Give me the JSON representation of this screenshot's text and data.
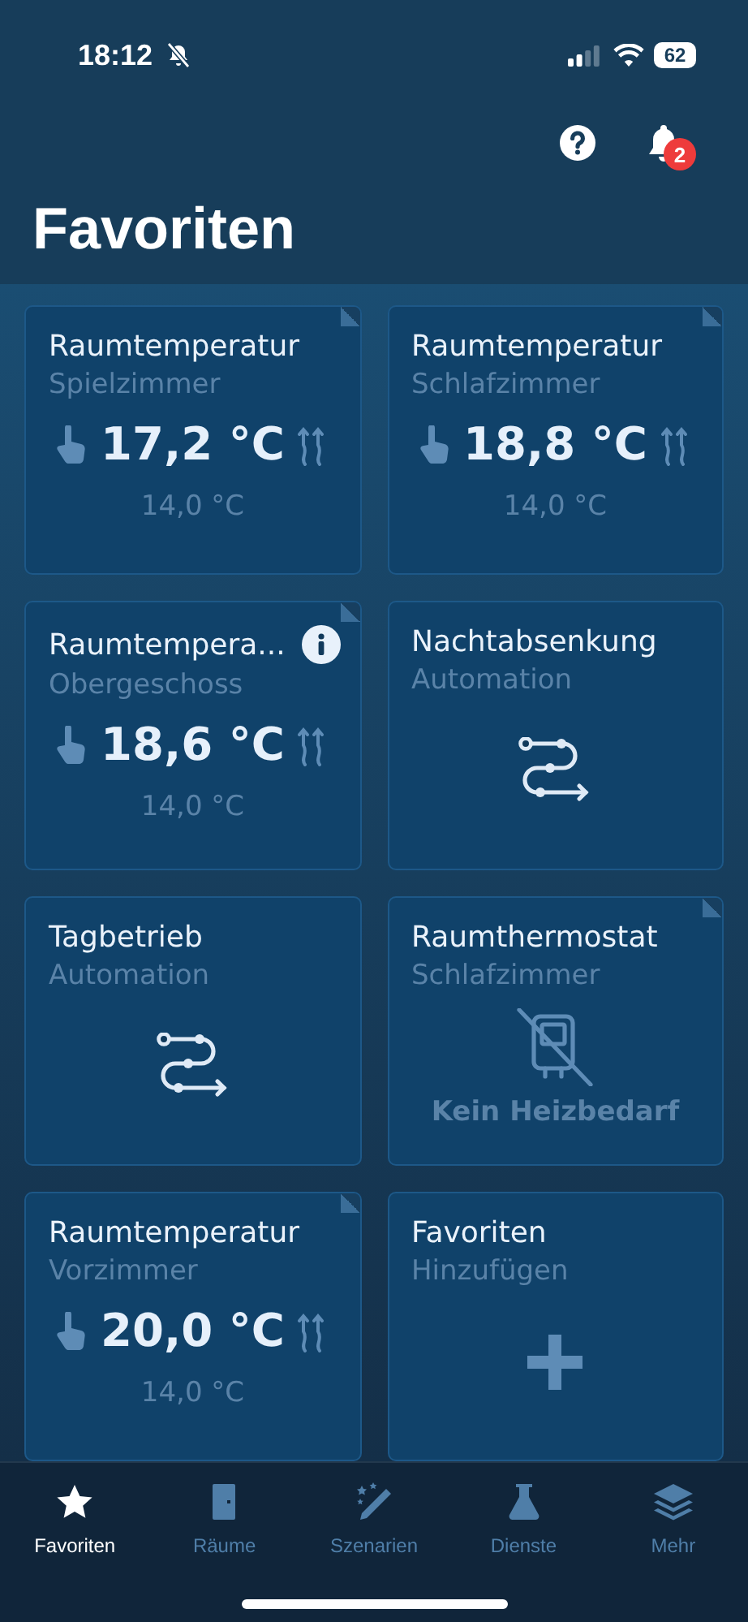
{
  "status_bar": {
    "time": "18:12",
    "battery": "62"
  },
  "header": {
    "notification_count": "2",
    "title": "Favoriten"
  },
  "cards": [
    {
      "kind": "temperature",
      "title": "Raumtemperatur",
      "subtitle": "Spielzimmer",
      "temperature": "17,2 °C",
      "setpoint": "14,0 °C",
      "corner": true,
      "info": false
    },
    {
      "kind": "temperature",
      "title": "Raumtemperatur",
      "subtitle": "Schlafzimmer",
      "temperature": "18,8 °C",
      "setpoint": "14,0 °C",
      "corner": true,
      "info": false
    },
    {
      "kind": "temperature",
      "title": "Raumtempera...",
      "subtitle": "Obergeschoss",
      "temperature": "18,6 °C",
      "setpoint": "14,0 °C",
      "corner": true,
      "info": true
    },
    {
      "kind": "automation",
      "title": "Nachtabsenkung",
      "subtitle": "Automation",
      "corner": false,
      "info": false
    },
    {
      "kind": "automation",
      "title": "Tagbetrieb",
      "subtitle": "Automation",
      "corner": false,
      "info": false
    },
    {
      "kind": "thermostat",
      "title": "Raumthermostat",
      "subtitle": "Schlafzimmer",
      "status": "Kein Heizbedarf",
      "corner": true,
      "info": false
    },
    {
      "kind": "temperature",
      "title": "Raumtemperatur",
      "subtitle": "Vorzimmer",
      "temperature": "20,0 °C",
      "setpoint": "14,0 °C",
      "corner": true,
      "info": false
    },
    {
      "kind": "add",
      "title": "Favoriten",
      "subtitle": "Hinzufügen",
      "corner": false,
      "info": false
    }
  ],
  "tabs": [
    {
      "label": "Favoriten",
      "selected": true
    },
    {
      "label": "Räume",
      "selected": false
    },
    {
      "label": "Szenarien",
      "selected": false
    },
    {
      "label": "Dienste",
      "selected": false
    },
    {
      "label": "Mehr",
      "selected": false
    }
  ]
}
